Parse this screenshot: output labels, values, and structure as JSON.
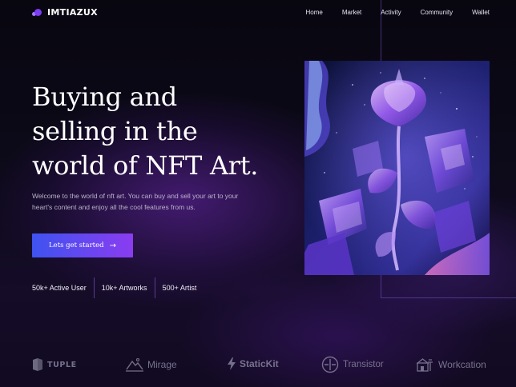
{
  "brand": {
    "name": "IMTIAZUX",
    "icon": "overlapping-circles-logo"
  },
  "nav": {
    "items": [
      {
        "label": "Home"
      },
      {
        "label": "Market"
      },
      {
        "label": "Activity"
      },
      {
        "label": "Community"
      },
      {
        "label": "Wallet"
      }
    ]
  },
  "hero": {
    "title_lines": [
      "Buying and",
      "selling in the",
      "world of NFT Art."
    ],
    "description": "Welcome to the world of nft art. You can buy and sell your art to your heart's content and enjoy all the cool features from us.",
    "cta_label": "Lets get started",
    "cta_icon": "arrow-right-icon"
  },
  "stats": [
    {
      "label": "50k+ Active User"
    },
    {
      "label": "10k+ Artworks"
    },
    {
      "label": "500+ Artist"
    }
  ],
  "artwork": {
    "description_icon": "crystal-rose-artwork"
  },
  "partners": [
    {
      "name": "TUPLE",
      "icon": "tuple-logo-icon"
    },
    {
      "name": "Mirage",
      "icon": "mirage-logo-icon"
    },
    {
      "name": "StaticKit",
      "icon": "lightning-icon"
    },
    {
      "name": "Transistor",
      "icon": "transistor-logo-icon"
    },
    {
      "name": "Workcation",
      "icon": "workcation-logo-icon"
    }
  ],
  "colors": {
    "background": "#0a0716",
    "accent_start": "#3f53f0",
    "accent_end": "#8a3cf0",
    "logo_purple": "#7a3cf5",
    "muted_text": "#b9b3c9",
    "partner_grey": "#77728c"
  }
}
